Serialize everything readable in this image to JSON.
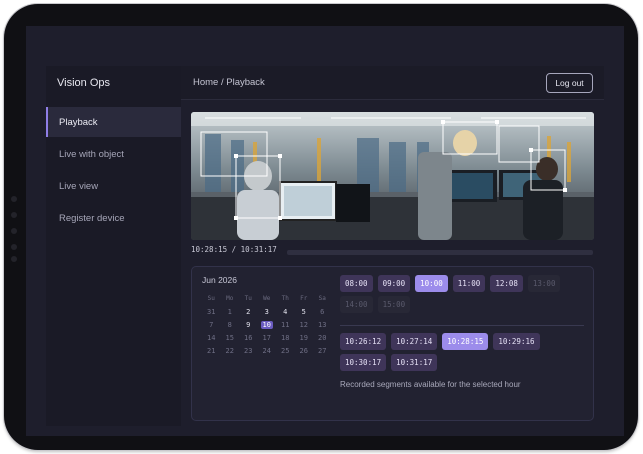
{
  "app": {
    "brand": "Vision Ops"
  },
  "nav": {
    "items": [
      {
        "label": "Playback",
        "active": true
      },
      {
        "label": "Live with object",
        "active": false
      },
      {
        "label": "Live view",
        "active": false
      },
      {
        "label": "Register device",
        "active": false
      }
    ]
  },
  "header": {
    "breadcrumb": "Home / Playback",
    "logout_label": "Log out"
  },
  "player": {
    "timecode": "10:28:15 / 10:31:17",
    "progress": 0.0
  },
  "calendar": {
    "month": "Jun 2026",
    "weekdays": [
      "Su",
      "Mo",
      "Tu",
      "We",
      "Th",
      "Fr",
      "Sa"
    ],
    "selected_day": "10",
    "weeks": [
      [
        "31",
        "1",
        "2",
        "3",
        "4",
        "5",
        "6"
      ],
      [
        "7",
        "8",
        "9",
        "10",
        "11",
        "12",
        "13"
      ],
      [
        "14",
        "15",
        "16",
        "17",
        "18",
        "19",
        "20"
      ],
      [
        "21",
        "22",
        "23",
        "24",
        "25",
        "26",
        "27"
      ]
    ],
    "available_days": [
      "2",
      "3",
      "4",
      "5",
      "9",
      "10"
    ]
  },
  "hours": [
    {
      "label": "08:00",
      "state": "available"
    },
    {
      "label": "09:00",
      "state": "available"
    },
    {
      "label": "10:00",
      "state": "selected"
    },
    {
      "label": "11:00",
      "state": "available"
    },
    {
      "label": "12:08",
      "state": "available"
    },
    {
      "label": "13:00",
      "state": "disabled"
    },
    {
      "label": "14:00",
      "state": "disabled"
    },
    {
      "label": "15:00",
      "state": "disabled"
    }
  ],
  "segments": [
    {
      "label": "10:26:12",
      "state": "available"
    },
    {
      "label": "10:27:14",
      "state": "available"
    },
    {
      "label": "10:28:15",
      "state": "selected"
    },
    {
      "label": "10:29:16",
      "state": "available"
    },
    {
      "label": "10:30:17",
      "state": "available"
    },
    {
      "label": "10:31:17",
      "state": "available"
    }
  ],
  "segments_note": "Recorded segments available for the selected hour",
  "colors": {
    "accent": "#9c8ceb",
    "chip": "#3f3559",
    "background": "#1e1e2c",
    "sidebar": "#1a1a26"
  }
}
